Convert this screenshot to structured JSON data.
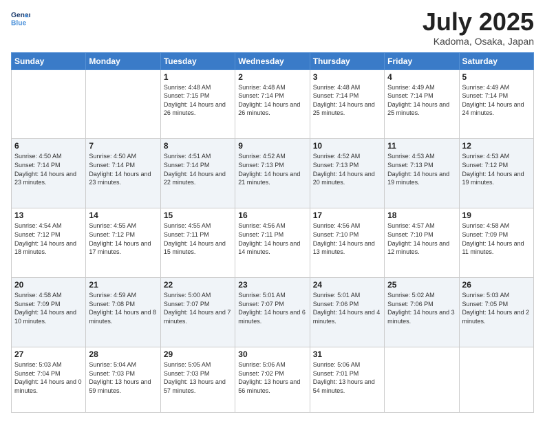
{
  "header": {
    "logo_line1": "General",
    "logo_line2": "Blue",
    "month": "July 2025",
    "location": "Kadoma, Osaka, Japan"
  },
  "weekdays": [
    "Sunday",
    "Monday",
    "Tuesday",
    "Wednesday",
    "Thursday",
    "Friday",
    "Saturday"
  ],
  "weeks": [
    [
      {
        "day": "",
        "info": ""
      },
      {
        "day": "",
        "info": ""
      },
      {
        "day": "1",
        "info": "Sunrise: 4:48 AM\nSunset: 7:15 PM\nDaylight: 14 hours and 26 minutes."
      },
      {
        "day": "2",
        "info": "Sunrise: 4:48 AM\nSunset: 7:14 PM\nDaylight: 14 hours and 26 minutes."
      },
      {
        "day": "3",
        "info": "Sunrise: 4:48 AM\nSunset: 7:14 PM\nDaylight: 14 hours and 25 minutes."
      },
      {
        "day": "4",
        "info": "Sunrise: 4:49 AM\nSunset: 7:14 PM\nDaylight: 14 hours and 25 minutes."
      },
      {
        "day": "5",
        "info": "Sunrise: 4:49 AM\nSunset: 7:14 PM\nDaylight: 14 hours and 24 minutes."
      }
    ],
    [
      {
        "day": "6",
        "info": "Sunrise: 4:50 AM\nSunset: 7:14 PM\nDaylight: 14 hours and 23 minutes."
      },
      {
        "day": "7",
        "info": "Sunrise: 4:50 AM\nSunset: 7:14 PM\nDaylight: 14 hours and 23 minutes."
      },
      {
        "day": "8",
        "info": "Sunrise: 4:51 AM\nSunset: 7:14 PM\nDaylight: 14 hours and 22 minutes."
      },
      {
        "day": "9",
        "info": "Sunrise: 4:52 AM\nSunset: 7:13 PM\nDaylight: 14 hours and 21 minutes."
      },
      {
        "day": "10",
        "info": "Sunrise: 4:52 AM\nSunset: 7:13 PM\nDaylight: 14 hours and 20 minutes."
      },
      {
        "day": "11",
        "info": "Sunrise: 4:53 AM\nSunset: 7:13 PM\nDaylight: 14 hours and 19 minutes."
      },
      {
        "day": "12",
        "info": "Sunrise: 4:53 AM\nSunset: 7:12 PM\nDaylight: 14 hours and 19 minutes."
      }
    ],
    [
      {
        "day": "13",
        "info": "Sunrise: 4:54 AM\nSunset: 7:12 PM\nDaylight: 14 hours and 18 minutes."
      },
      {
        "day": "14",
        "info": "Sunrise: 4:55 AM\nSunset: 7:12 PM\nDaylight: 14 hours and 17 minutes."
      },
      {
        "day": "15",
        "info": "Sunrise: 4:55 AM\nSunset: 7:11 PM\nDaylight: 14 hours and 15 minutes."
      },
      {
        "day": "16",
        "info": "Sunrise: 4:56 AM\nSunset: 7:11 PM\nDaylight: 14 hours and 14 minutes."
      },
      {
        "day": "17",
        "info": "Sunrise: 4:56 AM\nSunset: 7:10 PM\nDaylight: 14 hours and 13 minutes."
      },
      {
        "day": "18",
        "info": "Sunrise: 4:57 AM\nSunset: 7:10 PM\nDaylight: 14 hours and 12 minutes."
      },
      {
        "day": "19",
        "info": "Sunrise: 4:58 AM\nSunset: 7:09 PM\nDaylight: 14 hours and 11 minutes."
      }
    ],
    [
      {
        "day": "20",
        "info": "Sunrise: 4:58 AM\nSunset: 7:09 PM\nDaylight: 14 hours and 10 minutes."
      },
      {
        "day": "21",
        "info": "Sunrise: 4:59 AM\nSunset: 7:08 PM\nDaylight: 14 hours and 8 minutes."
      },
      {
        "day": "22",
        "info": "Sunrise: 5:00 AM\nSunset: 7:07 PM\nDaylight: 14 hours and 7 minutes."
      },
      {
        "day": "23",
        "info": "Sunrise: 5:01 AM\nSunset: 7:07 PM\nDaylight: 14 hours and 6 minutes."
      },
      {
        "day": "24",
        "info": "Sunrise: 5:01 AM\nSunset: 7:06 PM\nDaylight: 14 hours and 4 minutes."
      },
      {
        "day": "25",
        "info": "Sunrise: 5:02 AM\nSunset: 7:06 PM\nDaylight: 14 hours and 3 minutes."
      },
      {
        "day": "26",
        "info": "Sunrise: 5:03 AM\nSunset: 7:05 PM\nDaylight: 14 hours and 2 minutes."
      }
    ],
    [
      {
        "day": "27",
        "info": "Sunrise: 5:03 AM\nSunset: 7:04 PM\nDaylight: 14 hours and 0 minutes."
      },
      {
        "day": "28",
        "info": "Sunrise: 5:04 AM\nSunset: 7:03 PM\nDaylight: 13 hours and 59 minutes."
      },
      {
        "day": "29",
        "info": "Sunrise: 5:05 AM\nSunset: 7:03 PM\nDaylight: 13 hours and 57 minutes."
      },
      {
        "day": "30",
        "info": "Sunrise: 5:06 AM\nSunset: 7:02 PM\nDaylight: 13 hours and 56 minutes."
      },
      {
        "day": "31",
        "info": "Sunrise: 5:06 AM\nSunset: 7:01 PM\nDaylight: 13 hours and 54 minutes."
      },
      {
        "day": "",
        "info": ""
      },
      {
        "day": "",
        "info": ""
      }
    ]
  ]
}
